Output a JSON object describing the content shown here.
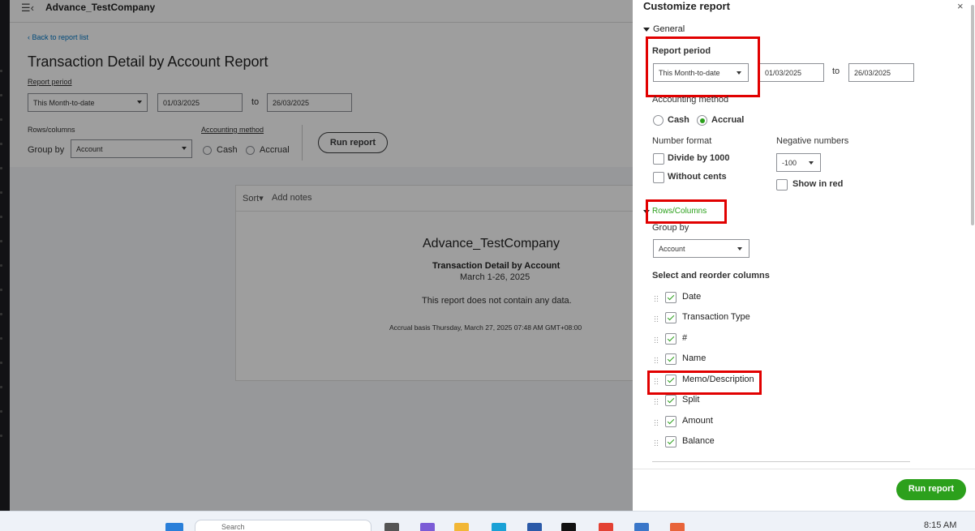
{
  "background": {
    "company_name": "Advance_TestCompany",
    "back_link": "Back to report list",
    "report_title": "Transaction Detail by Account Report",
    "report_period_label": "Report period",
    "report_period_value": "This Month-to-date",
    "date_from": "01/03/2025",
    "to_label": "to",
    "date_to": "26/03/2025",
    "rows_columns_label": "Rows/columns",
    "group_by_label": "Group by",
    "group_by_value": "Account",
    "accounting_method_label": "Accounting method",
    "cash_label": "Cash",
    "accrual_label": "Accrual",
    "run_report_label": "Run report",
    "sort_label": "Sort",
    "add_notes_label": "Add notes",
    "card_company": "Advance_TestCompany",
    "card_title": "Transaction Detail by Account",
    "card_dates": "March 1-26, 2025",
    "card_nodata": "This report does not contain any data.",
    "card_footer": "Accrual basis  Thursday, March 27, 2025  07:48 AM GMT+08:00"
  },
  "panel": {
    "title": "Customize report",
    "close_glyph": "×",
    "general_label": "General",
    "report_period_label": "Report period",
    "report_period_value": "This Month-to-date",
    "date_from": "01/03/2025",
    "to_label": "to",
    "date_to": "26/03/2025",
    "accounting_method_label": "Accounting method",
    "cash_label": "Cash",
    "accrual_label": "Accrual",
    "number_format_label": "Number format",
    "divide_label": "Divide by 1000",
    "without_cents_label": "Without cents",
    "negative_numbers_label": "Negative numbers",
    "negative_value": "-100",
    "show_in_red_label": "Show in red",
    "rows_columns_label": "Rows/Columns",
    "group_by_label": "Group by",
    "group_by_value": "Account",
    "select_columns_label": "Select and reorder columns",
    "columns": [
      {
        "label": "Date",
        "checked": true
      },
      {
        "label": "Transaction Type",
        "checked": true
      },
      {
        "label": "#",
        "checked": true
      },
      {
        "label": "Name",
        "checked": true
      },
      {
        "label": "Memo/Description",
        "checked": true
      },
      {
        "label": "Split",
        "checked": true
      },
      {
        "label": "Amount",
        "checked": true
      },
      {
        "label": "Balance",
        "checked": true
      }
    ],
    "run_report_label": "Run report",
    "accent_color": "#2ca01c",
    "highlight_color": "#e10000"
  },
  "taskbar": {
    "search_placeholder": "Search",
    "time": "8:15 AM"
  }
}
